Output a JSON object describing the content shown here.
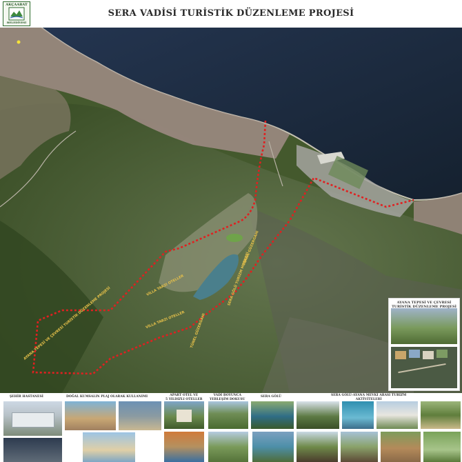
{
  "header": {
    "title": "SERA VADİSİ TURİSTİK DÜZENLEME PROJESİ",
    "logo_top": "AKÇAABAT",
    "logo_bottom": "BELEDİYESİ"
  },
  "map_labels": {
    "tunel_1": "TÜNEL GÜZERGAHI",
    "tunel_2": "TÜNEL GÜZERGAHI",
    "sera_golu_turizm": "SERA GÖLÜ TURİZM MERKEZİ",
    "villa_1": "VİLLA TARZI OTELLER",
    "villa_2": "VİLLA TARZI OTELLER",
    "ayana_tepesi": "AYANA TEPESİ VE ÇEVRESİ TURİSTİK DÜZENLEME PROJESİ"
  },
  "ayana_panel": {
    "title": "AYANA TEPESİ VE ÇEVRESİ\nTURİSTİK DÜZENLEME PROJESİ"
  },
  "captions": {
    "sehir_hastanesi": "ŞEHİR HASTANESİ",
    "dogal_kumsalin": "DOĞAL KUMSALIN PLAJ OLARAK KULLANIMI",
    "apart_otel": "APART OTEL VE\n5 YILDIZLI OTELLER",
    "vadi_boyunca": "VADİ BOYUNCA\nYERLEŞİM DOKUSU",
    "sera_golu": "SERA GÖLÜ",
    "sera_golu_ayana": "SERA GÖLÜ-AYANA MEVKİ ARASI TURİZM\nAKTİVİTELERİ"
  },
  "colors": {
    "sea": "#1d2c3f",
    "land_dark": "#3c5128",
    "land_mid": "#5d7341",
    "urban": "#a08f86",
    "boundary": "#e02020",
    "label": "#e6c04a",
    "lake": "#4a7f8c"
  }
}
